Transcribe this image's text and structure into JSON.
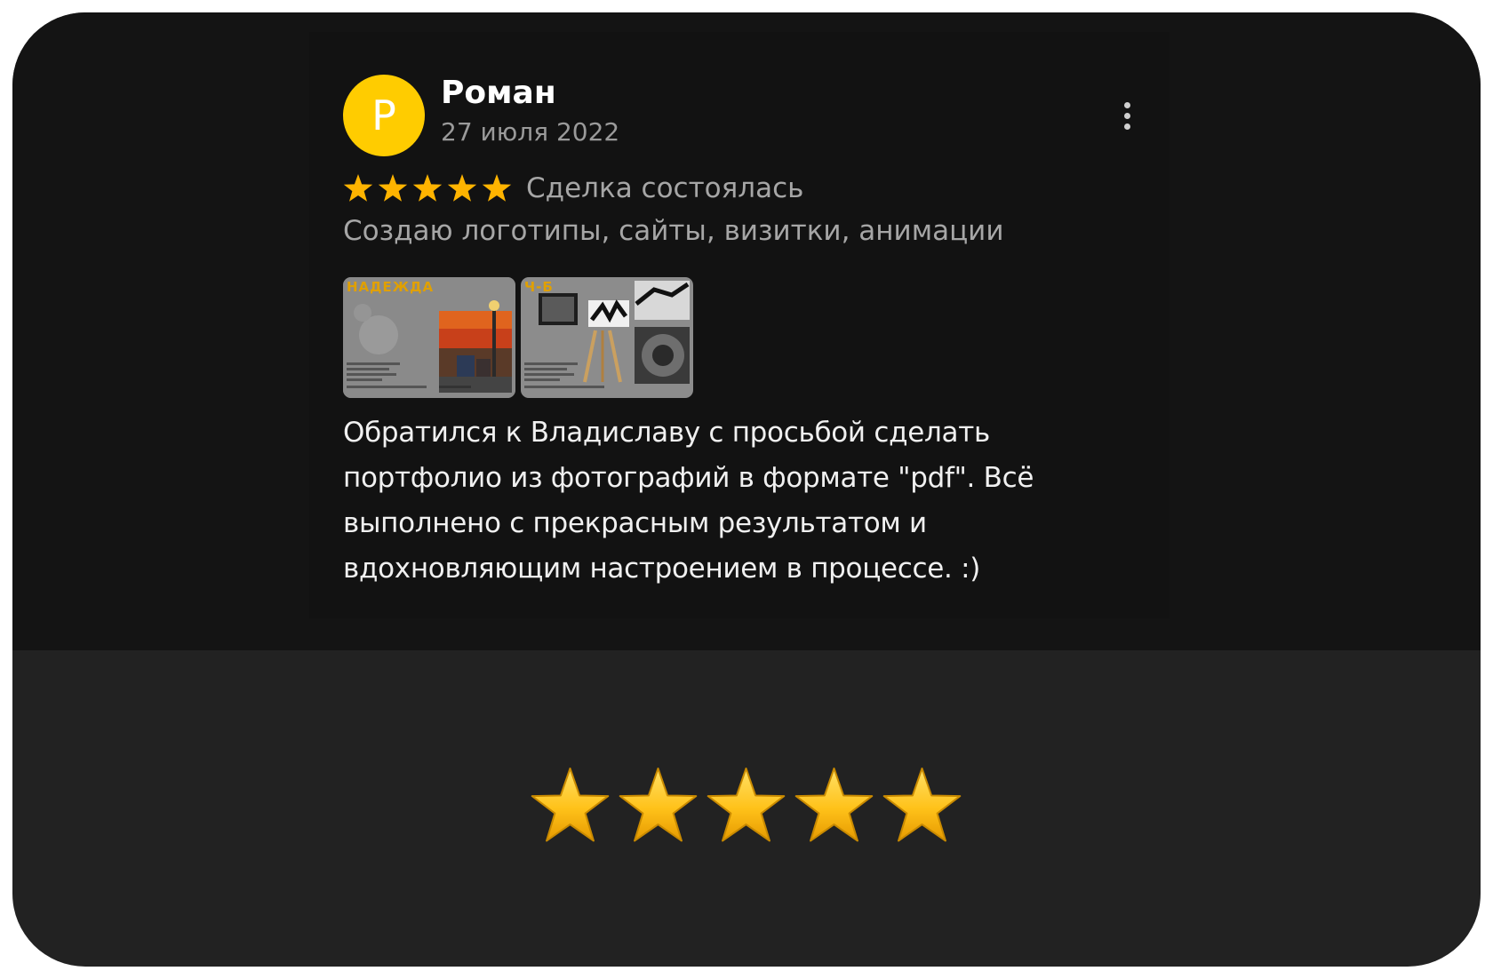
{
  "review": {
    "avatar_letter": "Р",
    "author": "Роман",
    "date": "27 июля 2022",
    "menu_icon": "more-vertical-icon",
    "rating": 5,
    "rating_max": 5,
    "deal_status": "Сделка состоялась",
    "service": "Создаю логотипы, сайты, визитки, анимации",
    "photos": [
      {
        "label": "НАДЕЖДА"
      },
      {
        "label": "Ч-Б"
      }
    ],
    "text": "Обратился к Владиславу с просьбой сделать портфолио из фотографий в формате \"pdf\". Всё выполнено с прекрасным результатом и вдохновляющим настроением в процессе. :)"
  },
  "summary": {
    "rating": 5,
    "rating_max": 5
  },
  "colors": {
    "avatar": "#ffcc00",
    "star": "#ffb400",
    "big_star": "#ffc21a"
  }
}
